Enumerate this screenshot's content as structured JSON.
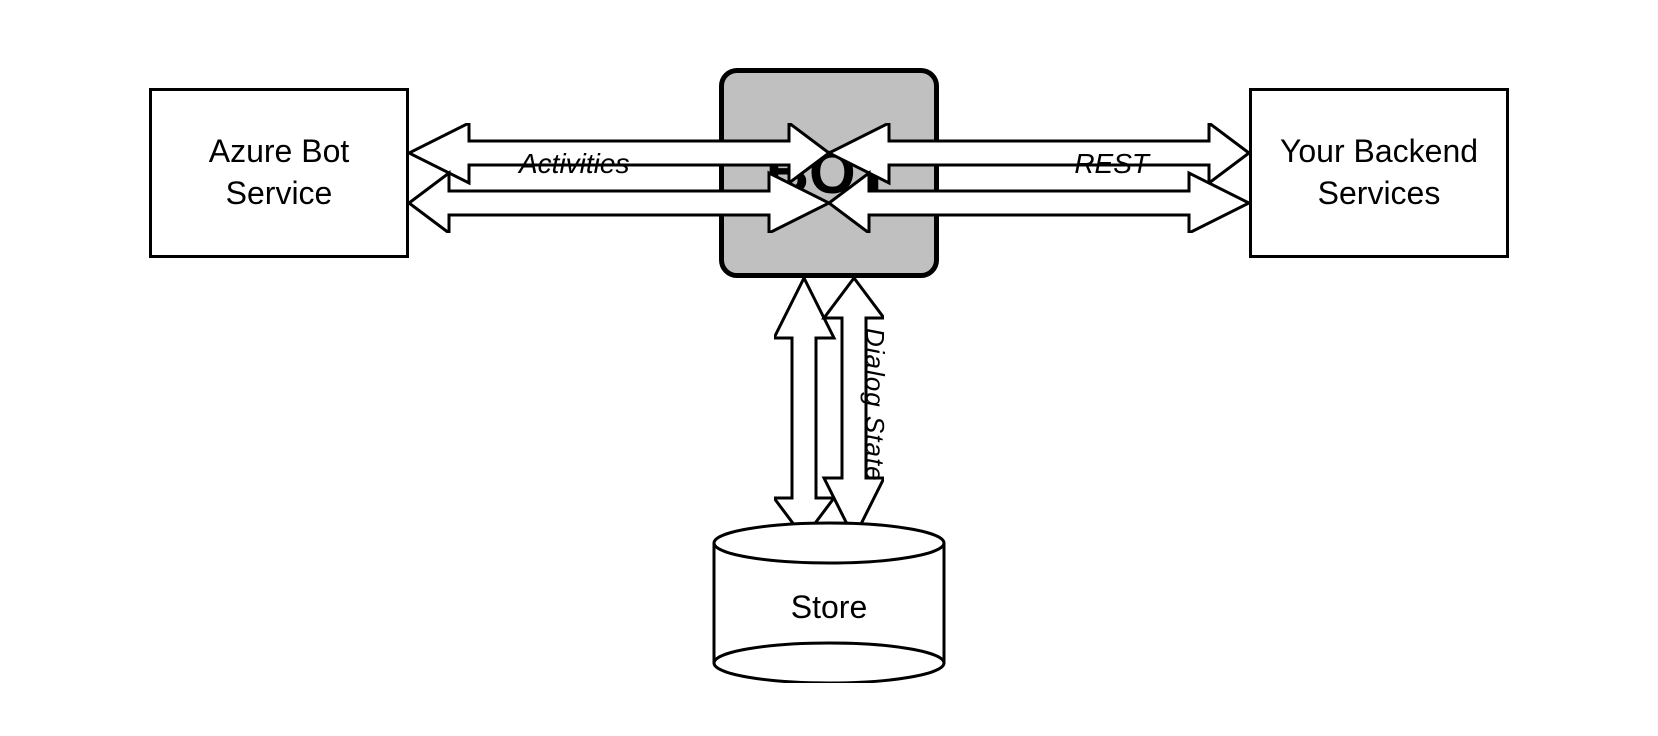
{
  "boxes": {
    "azure": {
      "label": "Azure Bot\nService"
    },
    "bot": {
      "label": "BOT"
    },
    "backend": {
      "label": "Your Backend\nServices"
    },
    "store": {
      "label": "Store"
    }
  },
  "arrows": {
    "activities_label": "Activities",
    "rest_label": "REST",
    "dialog_state_label": "Dialog State"
  }
}
